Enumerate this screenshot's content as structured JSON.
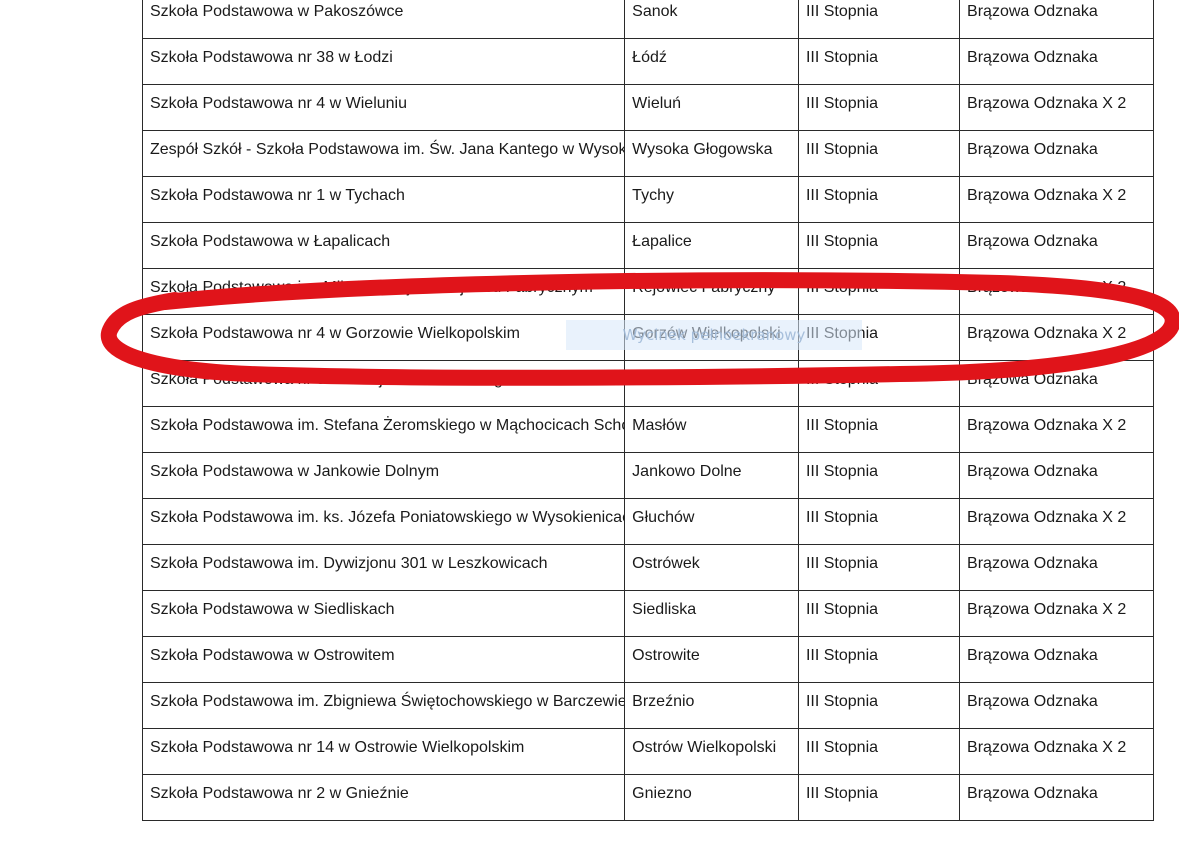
{
  "table": {
    "top_row": [
      "",
      "",
      "",
      ""
    ],
    "rows": [
      {
        "name": "Szkoła Podstawowa w Pakoszówce",
        "city": "Sanok",
        "degree": "III Stopnia",
        "award": "Brązowa Odznaka"
      },
      {
        "name": "Szkoła Podstawowa nr 38 w Łodzi",
        "city": "Łódź",
        "degree": "III Stopnia",
        "award": "Brązowa Odznaka"
      },
      {
        "name": "Szkoła Podstawowa nr 4 w Wieluniu",
        "city": "Wieluń",
        "degree": "III Stopnia",
        "award": "Brązowa Odznaka X 2"
      },
      {
        "name": "Zespół Szkół - Szkoła Podstawowa im. Św. Jana Kantego w Wysokiej Głogowskiej",
        "city": "Wysoka Głogowska",
        "degree": "III Stopnia",
        "award": "Brązowa Odznaka"
      },
      {
        "name": "Szkoła Podstawowa nr 1 w Tychach",
        "city": "Tychy",
        "degree": "III Stopnia",
        "award": "Brązowa Odznaka X 2"
      },
      {
        "name": "Szkoła Podstawowa w Łapalicach",
        "city": "Łapalice",
        "degree": "III Stopnia",
        "award": "Brązowa Odznaka"
      },
      {
        "name": "Szkoła Podstawowa im. Mikołaja Reja w Rejowcu Fabrycznym",
        "city": "Rejowiec Fabryczny",
        "degree": "III Stopnia",
        "award": "Brązowa Odznaka X 2"
      },
      {
        "name": "Szkoła Podstawowa nr 4 w Gorzowie Wielkopolskim",
        "city": "Gorzów Wielkopolski",
        "degree": "III Stopnia",
        "award": "Brązowa Odznaka X 2"
      },
      {
        "name": "Szkoła Podstawowa nr 8 im. Wojciecha Korfantego w Mikołowie",
        "city": "Mikołów",
        "degree": "III Stopnia",
        "award": "Brązowa Odznaka"
      },
      {
        "name": "Szkoła Podstawowa im. Stefana Żeromskiego w Mąchocicach Scholasterii",
        "city": "Masłów",
        "degree": "III Stopnia",
        "award": "Brązowa Odznaka X 2"
      },
      {
        "name": "Szkoła Podstawowa w Jankowie Dolnym",
        "city": "Jankowo Dolne",
        "degree": "III Stopnia",
        "award": "Brązowa Odznaka"
      },
      {
        "name": "Szkoła Podstawowa im. ks. Józefa Poniatowskiego w Wysokienicach",
        "city": "Głuchów",
        "degree": "III Stopnia",
        "award": "Brązowa Odznaka X 2"
      },
      {
        "name": "Szkoła Podstawowa im. Dywizjonu 301 w Leszkowicach",
        "city": "Ostrówek",
        "degree": "III Stopnia",
        "award": "Brązowa Odznaka"
      },
      {
        "name": "Szkoła Podstawowa w Siedliskach",
        "city": "Siedliska",
        "degree": "III Stopnia",
        "award": "Brązowa Odznaka X 2"
      },
      {
        "name": "Szkoła Podstawowa w Ostrowitem",
        "city": "Ostrowite",
        "degree": "III Stopnia",
        "award": "Brązowa Odznaka"
      },
      {
        "name": "Szkoła Podstawowa im. Zbigniewa Świętochowskiego w Barczewie",
        "city": "Brzeźnio",
        "degree": "III Stopnia",
        "award": "Brązowa Odznaka"
      },
      {
        "name": "Szkoła Podstawowa nr 14 w Ostrowie Wielkopolskim",
        "city": "Ostrów Wielkopolski",
        "degree": "III Stopnia",
        "award": "Brązowa Odznaka X 2"
      },
      {
        "name": "Szkoła Podstawowa nr 2 w Gnieźnie",
        "city": "Gniezno",
        "degree": "III Stopnia",
        "award": "Brązowa Odznaka"
      }
    ]
  },
  "overlay": {
    "watermark_text": "Wycinek pełnoekranowy",
    "annotation_color": "#e0141a"
  }
}
